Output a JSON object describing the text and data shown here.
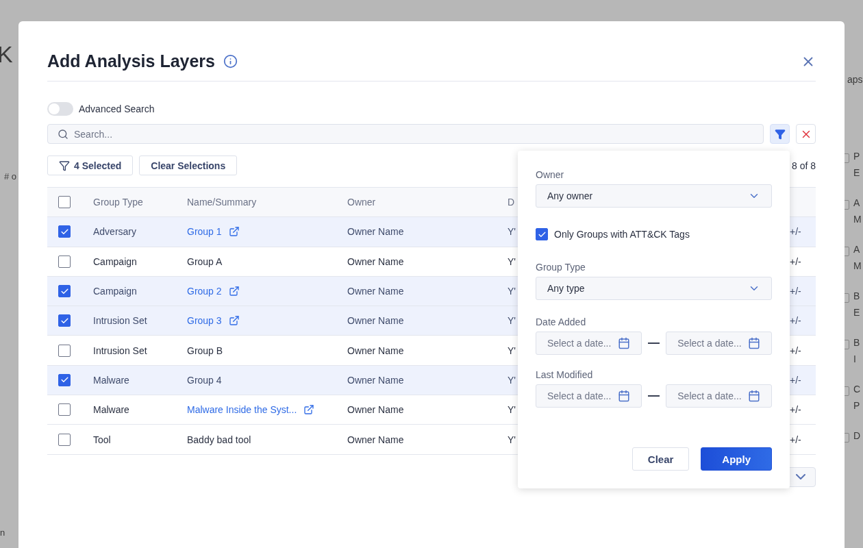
{
  "backdrop": {
    "left_texts": [
      "K",
      "# o",
      "n"
    ],
    "right_header": "aps",
    "right_rows": [
      {
        "checked": false,
        "lines": [
          "P",
          "E"
        ]
      },
      {
        "checked": false,
        "lines": [
          "A",
          "M"
        ]
      },
      {
        "checked": false,
        "lines": [
          "A",
          "M"
        ]
      },
      {
        "checked": false,
        "lines": [
          "B",
          "E"
        ]
      },
      {
        "checked": false,
        "lines": [
          "B",
          "I"
        ]
      },
      {
        "checked": false,
        "lines": [
          "C",
          "P"
        ]
      },
      {
        "checked": false,
        "lines": [
          "D"
        ]
      }
    ]
  },
  "dialog": {
    "title": "Add Analysis Layers",
    "advanced_search": {
      "label": "Advanced Search",
      "on": false
    },
    "search": {
      "placeholder": "Search..."
    },
    "filter_active": true,
    "selected_button": "4 Selected",
    "clear_selections": "Clear Selections",
    "count": "8 of 8",
    "table": {
      "columns": [
        "Group Type",
        "Name/Summary",
        "Owner",
        "D"
      ],
      "all_checked": false,
      "rows": [
        {
          "checked": true,
          "group_type": "Adversary",
          "name": "Group 1",
          "link": true,
          "owner": "Owner Name",
          "column_4": "Y'",
          "action": "+/-"
        },
        {
          "checked": false,
          "group_type": "Campaign",
          "name": "Group A",
          "link": false,
          "owner": "Owner Name",
          "column_4": "Y'",
          "action": "+/-"
        },
        {
          "checked": true,
          "group_type": "Campaign",
          "name": "Group 2",
          "link": true,
          "owner": "Owner Name",
          "column_4": "Y'",
          "action": "+/-"
        },
        {
          "checked": true,
          "group_type": "Intrusion Set",
          "name": "Group 3",
          "link": true,
          "owner": "Owner Name",
          "column_4": "Y'",
          "action": "+/-"
        },
        {
          "checked": false,
          "group_type": "Intrusion Set",
          "name": "Group B",
          "link": false,
          "owner": "Owner Name",
          "column_4": "Y'",
          "action": "+/-"
        },
        {
          "checked": true,
          "group_type": "Malware",
          "name": "Group 4",
          "link": false,
          "owner": "Owner Name",
          "column_4": "Y'",
          "action": "+/-"
        },
        {
          "checked": false,
          "group_type": "Malware",
          "name": "Malware Inside the Syst...",
          "link": true,
          "owner": "Owner Name",
          "column_4": "Y'",
          "action": "+/-"
        },
        {
          "checked": false,
          "group_type": "Tool",
          "name": "Baddy bad tool",
          "link": false,
          "owner": "Owner Name",
          "column_4": "Y'",
          "action": "+/-"
        }
      ]
    },
    "filter_popover": {
      "owner": {
        "label": "Owner",
        "value": "Any owner"
      },
      "attack_tags": {
        "label": "Only Groups with ATT&CK Tags",
        "checked": true
      },
      "group_type": {
        "label": "Group Type",
        "value": "Any type"
      },
      "date_added": {
        "label": "Date Added",
        "from_placeholder": "Select a date...",
        "to_placeholder": "Select a date..."
      },
      "last_modified": {
        "label": "Last Modified",
        "from_placeholder": "Select a date...",
        "to_placeholder": "Select a date..."
      },
      "clear": "Clear",
      "apply": "Apply"
    }
  }
}
